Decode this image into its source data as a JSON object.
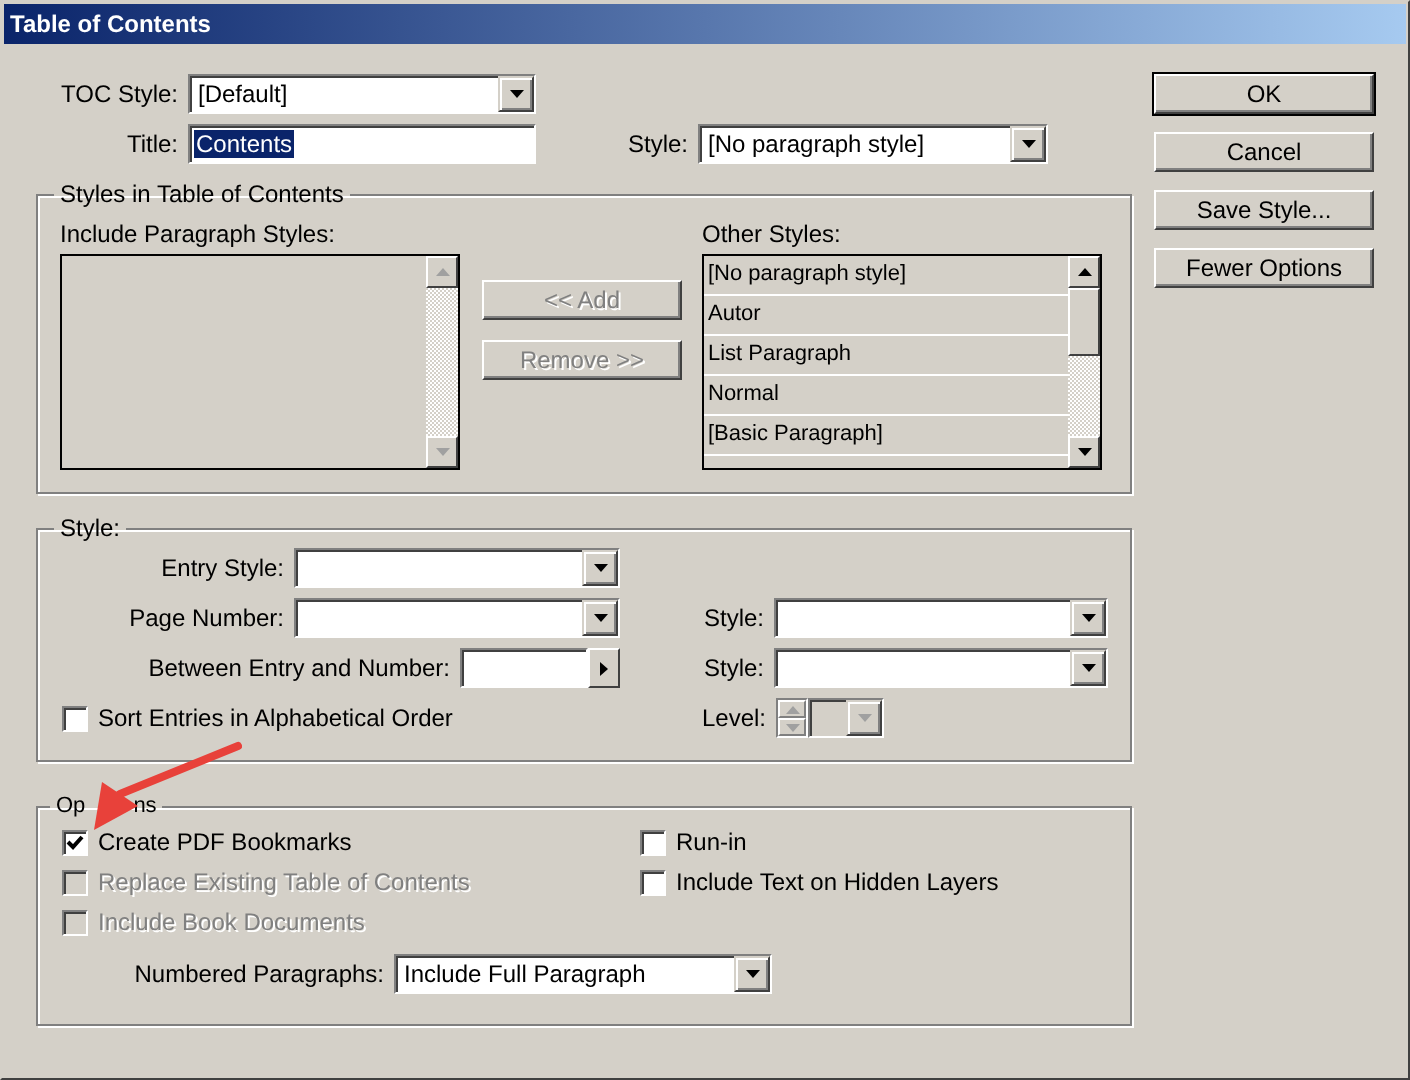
{
  "window": {
    "title": "Table of Contents"
  },
  "toc_style": {
    "label": "TOC Style:",
    "value": "[Default]"
  },
  "title": {
    "label": "Title:",
    "value": "Contents",
    "selected": true
  },
  "title_style": {
    "label": "Style:",
    "value": "[No paragraph style]"
  },
  "buttons": [
    {
      "label": "OK",
      "default": true
    },
    {
      "label": "Cancel",
      "default": false
    },
    {
      "label": "Save Style...",
      "default": false
    },
    {
      "label": "Fewer Options",
      "default": false
    }
  ],
  "styles_group": {
    "legend": "Styles in Table of Contents",
    "include_label": {
      "label": "Include Paragraph Styles:"
    },
    "add_button": {
      "label": "<< Add",
      "disabled": true
    },
    "remove_button": {
      "label": "Remove >>",
      "disabled": true
    },
    "other_label": {
      "label": "Other Styles:"
    },
    "other_items": [
      "[No paragraph style]",
      "Autor",
      "List Paragraph",
      "Normal",
      "[Basic Paragraph]"
    ]
  },
  "style_group": {
    "legend": "Style:",
    "entry_style": {
      "label": "Entry Style:"
    },
    "page_number": {
      "label": "Page Number:"
    },
    "page_number_style": {
      "label": "Style:"
    },
    "between": {
      "label": "Between Entry and Number:"
    },
    "between_style": {
      "label": "Style:"
    },
    "sort": {
      "label": "Sort Entries in Alphabetical Order",
      "checked": false
    },
    "level": {
      "label": "Level:",
      "disabled": true
    }
  },
  "options_group": {
    "legend_parts": [
      "Op",
      "ns"
    ],
    "left": [
      {
        "label": "Create PDF Bookmarks",
        "checked": true,
        "disabled": false
      },
      {
        "label": "Replace Existing Table of Contents",
        "checked": false,
        "disabled": true
      },
      {
        "label": "Include Book Documents",
        "checked": false,
        "disabled": true
      }
    ],
    "right": [
      {
        "label": "Run-in",
        "checked": false,
        "disabled": false
      },
      {
        "label": "Include Text on Hidden Layers",
        "checked": false,
        "disabled": false
      }
    ],
    "numbered_paragraphs": {
      "label": "Numbered Paragraphs:",
      "value": "Include Full Paragraph"
    }
  }
}
